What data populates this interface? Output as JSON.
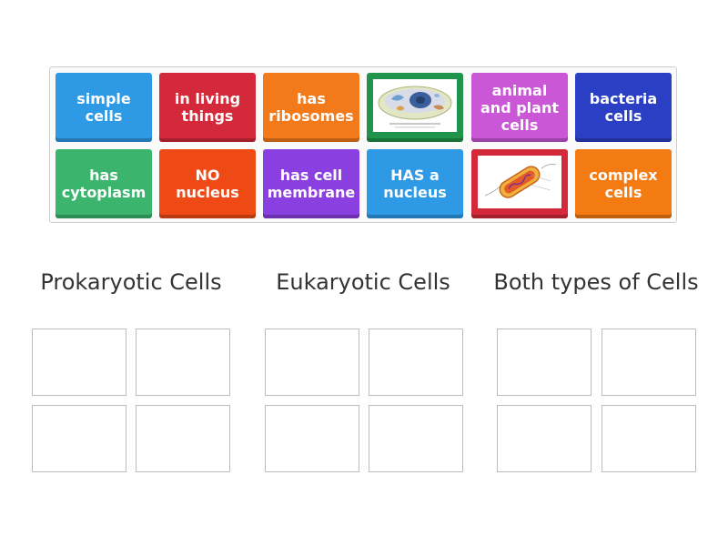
{
  "tiles": [
    {
      "type": "text",
      "label": "simple\ncells",
      "color": "#2e9ae6"
    },
    {
      "type": "text",
      "label": "in living\nthings",
      "color": "#d3293a"
    },
    {
      "type": "text",
      "label": "has\nribosomes",
      "color": "#f27a1a"
    },
    {
      "type": "image",
      "icon": "animal-cell-diagram-icon",
      "color": "#20944a"
    },
    {
      "type": "text",
      "label": "animal\nand plant\ncells",
      "color": "#c957d6"
    },
    {
      "type": "text",
      "label": "bacteria\ncells",
      "color": "#2b3fc4"
    },
    {
      "type": "text",
      "label": "has\ncytoplasm",
      "color": "#3bb56e"
    },
    {
      "type": "text",
      "label": "NO\nnucleus",
      "color": "#ef4a16"
    },
    {
      "type": "text",
      "label": "has cell\nmembrane",
      "color": "#8a3fe0"
    },
    {
      "type": "text",
      "label": "HAS a\nnucleus",
      "color": "#2e9ae6"
    },
    {
      "type": "image",
      "icon": "bacteria-cell-diagram-icon",
      "color": "#d3293a"
    },
    {
      "type": "text",
      "label": "complex\ncells",
      "color": "#f47a12"
    }
  ],
  "categories": [
    {
      "title": "Prokaryotic Cells"
    },
    {
      "title": "Eukaryotic Cells"
    },
    {
      "title": "Both types of Cells"
    }
  ]
}
